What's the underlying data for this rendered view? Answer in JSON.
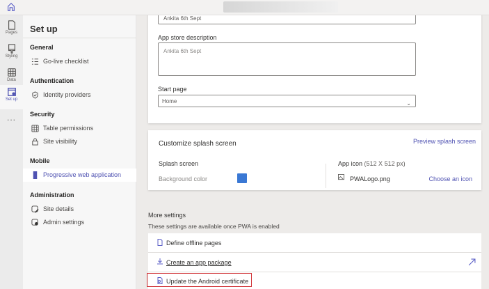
{
  "topbar": {
    "home_icon": "home-icon"
  },
  "rail": [
    {
      "label": "Pages",
      "icon": "page-icon"
    },
    {
      "label": "Styling",
      "icon": "brush-icon"
    },
    {
      "label": "Data",
      "icon": "table-icon"
    },
    {
      "label": "Set up",
      "icon": "setup-icon",
      "active": true
    },
    {
      "label": "...",
      "icon": "more-icon"
    }
  ],
  "sidebar": {
    "title": "Set up",
    "sections": [
      {
        "heading": "General",
        "items": [
          {
            "label": "Go-live checklist"
          }
        ]
      },
      {
        "heading": "Authentication",
        "items": [
          {
            "label": "Identity providers"
          }
        ]
      },
      {
        "heading": "Security",
        "items": [
          {
            "label": "Table permissions"
          },
          {
            "label": "Site visibility"
          }
        ]
      },
      {
        "heading": "Mobile",
        "items": [
          {
            "label": "Progressive web application",
            "active": true
          }
        ]
      },
      {
        "heading": "Administration",
        "items": [
          {
            "label": "Site details"
          },
          {
            "label": "Admin settings"
          }
        ]
      }
    ]
  },
  "form": {
    "name_value": "Ankita 6th Sept",
    "description_label": "App store description",
    "description_value": "Ankita 6th Sept",
    "start_page_label": "Start page",
    "start_page_value": "Home"
  },
  "splash": {
    "title": "Customize splash screen",
    "preview_link": "Preview splash screen",
    "splash_heading": "Splash screen",
    "bg_color_label": "Background color",
    "bg_color": "#3a78d4",
    "app_icon_heading": "App icon",
    "app_icon_size": "(512 X 512 px)",
    "icon_file": "PWALogo.png",
    "choose_icon_link": "Choose an icon"
  },
  "more": {
    "title": "More settings",
    "subtitle": "These settings are available once PWA is enabled",
    "rows": [
      {
        "label": "Define offline pages"
      },
      {
        "label": "Create an app package"
      },
      {
        "label": "Update the Android certificate"
      }
    ]
  },
  "colors": {
    "accent": "#4f52b2",
    "highlight": "#d13438"
  }
}
